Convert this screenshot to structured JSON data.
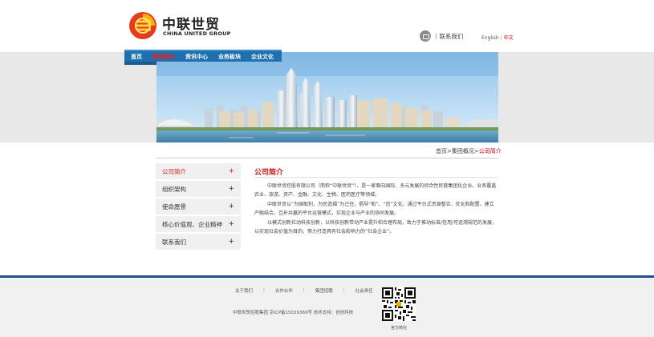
{
  "header": {
    "logo_cn": "中联世贸",
    "logo_en": "CHINA UNITED GROUP",
    "contact_label": "联系我们",
    "lang_en": "English",
    "lang_cn": "中文"
  },
  "nav": {
    "items": [
      "首页",
      "集团概况",
      "资讯中心",
      "业务板块",
      "企业文化"
    ],
    "active_index": 1
  },
  "breadcrumb": {
    "home": "首页",
    "parent": "集团概况",
    "current": "公司简介"
  },
  "sidebar": {
    "items": [
      "公司简介",
      "组织架构",
      "使命愿景",
      "核心价值观、企业精神",
      "联系我们"
    ],
    "active_index": 0
  },
  "main": {
    "title": "公司简介",
    "paragraphs": [
      "中联世贸控股有限公司（简称“中联世贸”），是一家面向国际、多元发展的综合性民营集团化企业。业务覆盖农业、旅游、资产、金融、文化、生物、医药医疗等领域。",
      "中联世贸以“为国取利，为民造福”为己任，倡导“和”、“信”文化，通过平台式资源整合，优化和配置，建立产融结合，互补共赢的平台运营模式，实现企业与产业的协同发展。",
      "以模式创新拉动科技创新，以科技创新带动产业提升和合理布局，致力于推动标准/信用/可追溯规范的发展，以实现社会价值为目的，努力打造具有社会影响力的“社会企业”。"
    ]
  },
  "footer": {
    "links": [
      "关于我们",
      "合作伙伴",
      "集团招聘",
      "社会责任"
    ],
    "copyright": "中联世贸控股集团    京ICP备15029369号 技术支持：创信科技",
    "qr_label": "官方微信"
  },
  "colors": {
    "accent_red": "#d21a1a",
    "nav_blue": "#1f6fae",
    "footer_border": "#1f4f8f"
  }
}
